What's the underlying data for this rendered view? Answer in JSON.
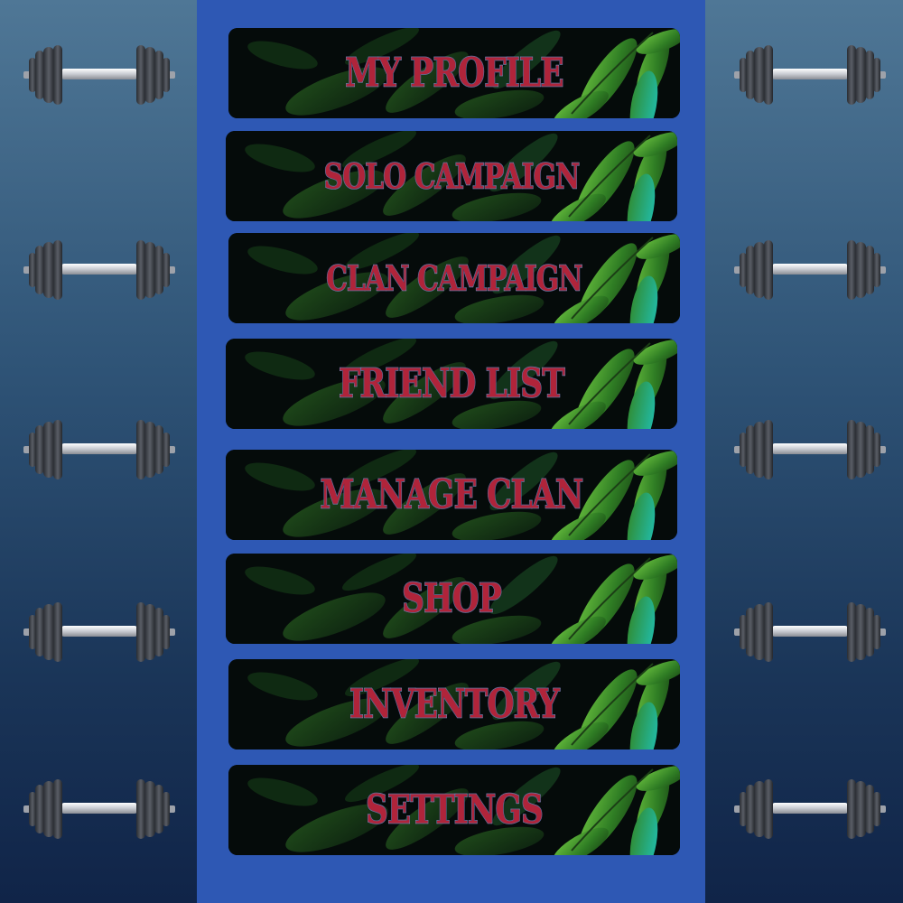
{
  "menu": {
    "items": [
      {
        "id": "my-profile",
        "label": "MY PROFILE"
      },
      {
        "id": "solo-campaign",
        "label": "SOLO CAMPAIGN"
      },
      {
        "id": "clan-campaign",
        "label": "CLAN CAMPAIGN"
      },
      {
        "id": "friend-list",
        "label": "FRIEND LIST"
      },
      {
        "id": "manage-clan",
        "label": "MANAGE CLAN"
      },
      {
        "id": "shop",
        "label": "SHOP"
      },
      {
        "id": "inventory",
        "label": "INVENTORY"
      },
      {
        "id": "settings",
        "label": "SETTINGS"
      }
    ]
  },
  "decorations": {
    "side_icon": "dumbbell-icon"
  },
  "colors": {
    "panel": "#2e58b4",
    "label_fill": "#b0243a",
    "label_outline": "#8e98c4",
    "button_bg": "#050b0a",
    "leaf": "#3f8c2a"
  }
}
